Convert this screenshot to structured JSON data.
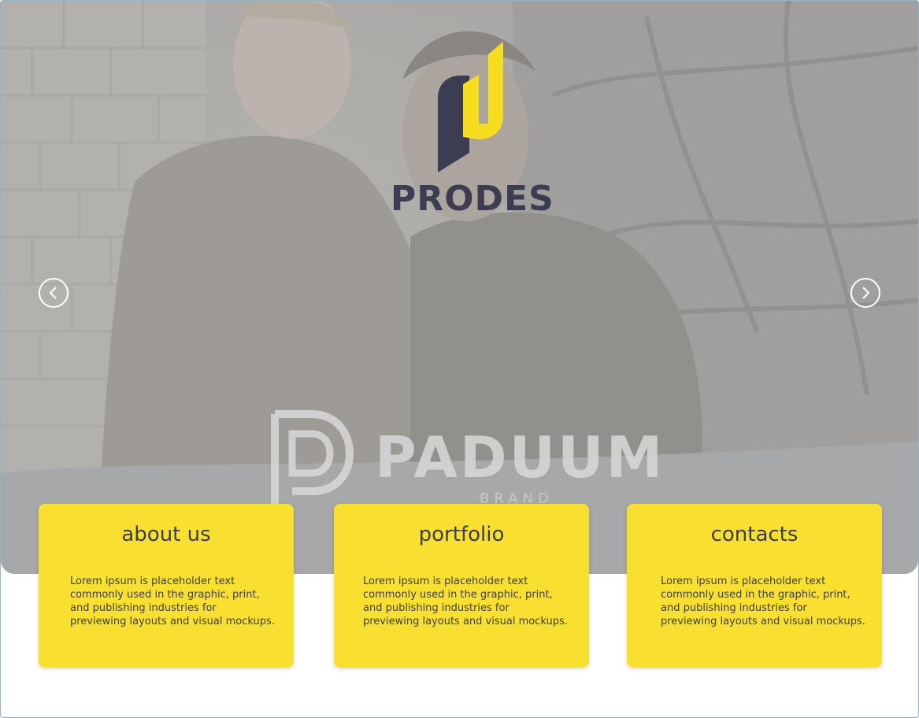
{
  "hero": {
    "brand_name": "PRODES",
    "watermark_name": "PADUUM",
    "watermark_sub": "BRAND",
    "prev_icon": "chevron-left-icon",
    "next_icon": "chevron-right-icon"
  },
  "colors": {
    "accent": "#f9e030",
    "dark": "#3c3d52",
    "logo_yellow": "#f6dd1f"
  },
  "cards": [
    {
      "title": "about us",
      "text": "Lorem ipsum is placeholder text commonly used in the graphic, print, and publishing industries for previewing layouts and visual mockups."
    },
    {
      "title": "portfolio",
      "text": "Lorem ipsum is placeholder text commonly used in the graphic, print, and publishing industries for previewing layouts and visual mockups."
    },
    {
      "title": "contacts",
      "text": "Lorem ipsum is placeholder text commonly used in the graphic, print, and publishing industries for previewing layouts and visual mockups."
    }
  ]
}
